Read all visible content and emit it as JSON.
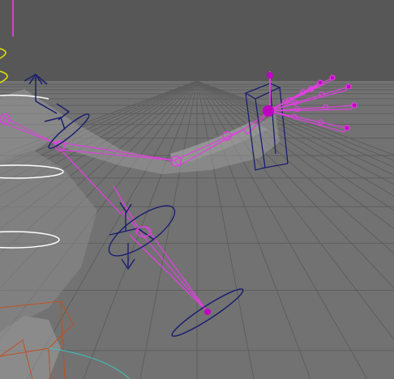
{
  "viewport": {
    "name": "3d-viewport",
    "colors": {
      "background_top": "#575757",
      "background_floor": "#747474",
      "grid_line": "#5c5c5c",
      "joint_magenta": "#e040e0",
      "joint_selected": "#c000c0",
      "control_navy": "#1a1f6e",
      "locator_white": "#ffffff",
      "handle_yellow": "#e0e000",
      "crate_orange": "#c05020",
      "curve_cyan": "#40c0c0"
    },
    "controls": [
      {
        "name": "wrist-ik-box-control",
        "kind": "box"
      },
      {
        "name": "shoulder-translate-gizmo",
        "kind": "move-arrows"
      },
      {
        "name": "elbow-rotate-gizmo",
        "kind": "rotate-ring"
      },
      {
        "name": "pole-vector-ring",
        "kind": "ring"
      }
    ],
    "skeleton": {
      "arm_joints": [
        "shoulder",
        "upper-arm",
        "elbow",
        "wrist"
      ],
      "finger_count": 5
    }
  }
}
